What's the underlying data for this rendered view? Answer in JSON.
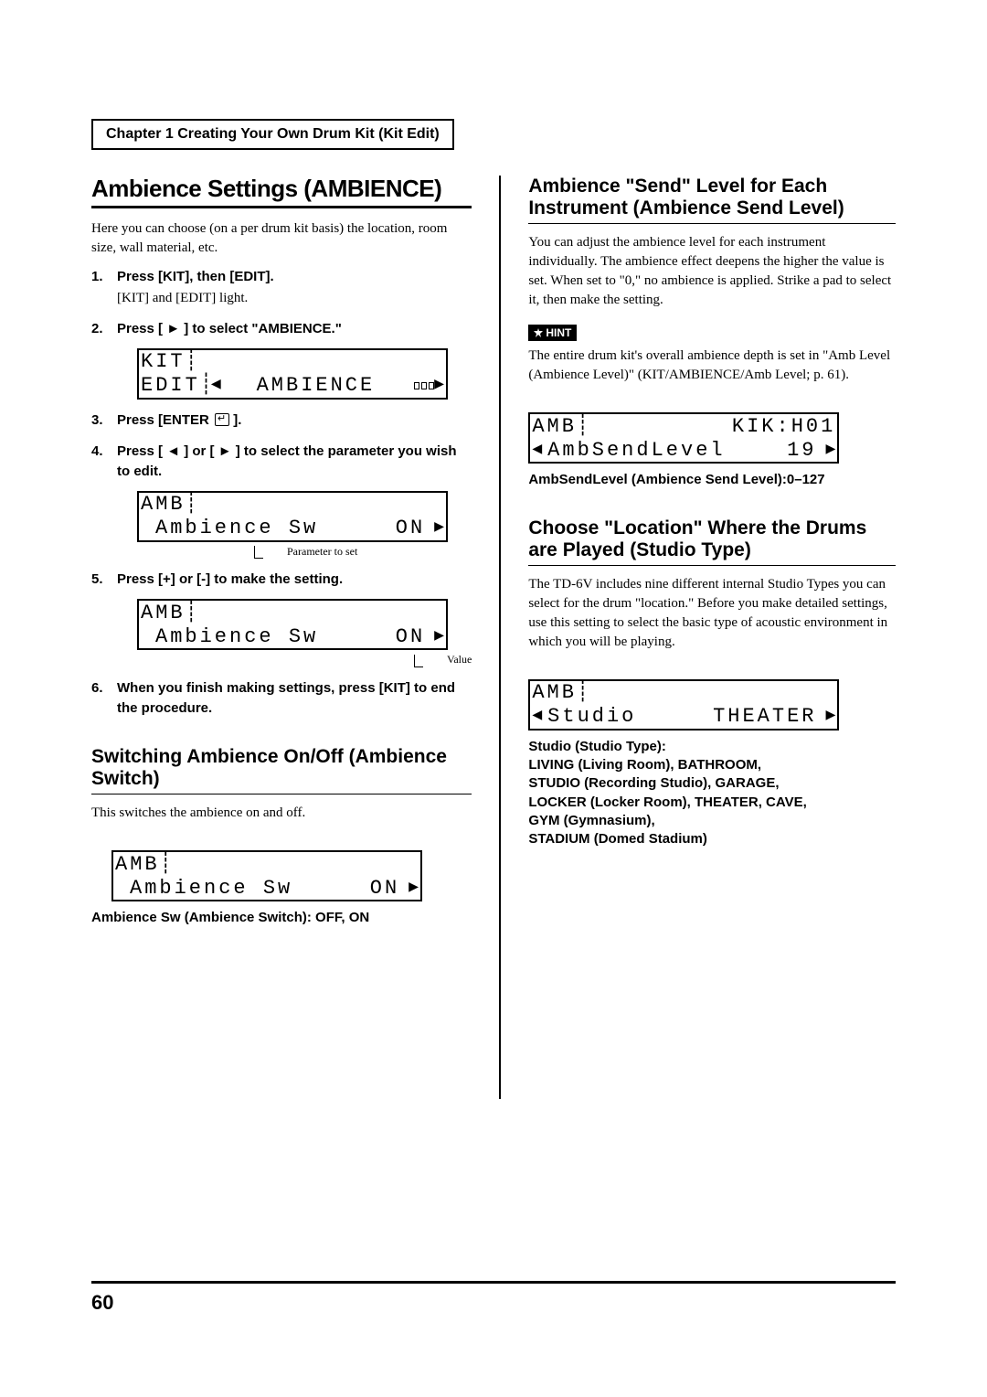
{
  "chapter_header": "Chapter 1 Creating Your Own Drum Kit (Kit Edit)",
  "page_number": "60",
  "left": {
    "h1": "Ambience Settings (AMBIENCE)",
    "intro": "Here you can choose (on a per drum kit basis) the location, room size, wall material, etc.",
    "steps": {
      "s1_bold": "Press [KIT], then [EDIT].",
      "s1_note": "[KIT] and [EDIT] light.",
      "s2_bold_a": "Press [ ",
      "s2_bold_b": " ] to select \"AMBIENCE.\"",
      "s3_bold": "Press [ENTER ",
      "s3_bold_b": " ].",
      "s4_bold_a": "Press [ ",
      "s4_bold_mid": " ] or [ ",
      "s4_bold_b": " ] to select the parameter you wish to edit.",
      "s5_bold": "Press [+] or [-] to make the setting.",
      "s6_bold": "When you finish making settings, press [KIT] to end the procedure."
    },
    "callout_param": "Parameter to set",
    "callout_value": "Value",
    "sub_h2": "Switching Ambience On/Off (Ambience Switch)",
    "sub_body": "This switches the ambience on and off.",
    "sub_param_line": "Ambience Sw (Ambience Switch): OFF, ON",
    "lcd_kit": {
      "row1_a": "KIT",
      "row2_a": "EDIT",
      "row2_mid": "AMBIENCE"
    },
    "lcd_amb1": {
      "row1": "AMB",
      "row2_a": "Ambience Sw",
      "row2_b": "ON"
    },
    "lcd_amb2": {
      "row1": "AMB",
      "row2_a": "Ambience Sw",
      "row2_b": "ON"
    },
    "lcd_amb3": {
      "row1": "AMB",
      "row2_a": "Ambience Sw",
      "row2_b": "ON"
    }
  },
  "right": {
    "h2a": "Ambience \"Send\" Level for Each Instrument (Ambience Send Level)",
    "body_a": "You can adjust the ambience level for each instrument individually. The ambience effect deepens the higher the value is set. When set to \"0,\" no ambience is applied. Strike a pad to select it, then make the setting.",
    "hint_label": "HINT",
    "hint_body": "The entire drum kit's overall ambience depth is set in \"Amb Level (Ambience Level)\" (KIT/AMBIENCE/Amb Level; p. 61).",
    "lcd_send": {
      "row1_a": "AMB",
      "row1_b": "KIK:H01",
      "row2_a": "AmbSendLevel",
      "row2_b": "19"
    },
    "send_param_line": "AmbSendLevel (Ambience Send Level):0–127",
    "h2b": "Choose \"Location\" Where the Drums are Played (Studio Type)",
    "body_b": "The TD-6V includes nine different internal Studio Types you can select for the drum \"location.\" Before you make detailed settings, use this setting to select the basic type of acoustic environment in which you will be playing.",
    "lcd_studio": {
      "row1": "AMB",
      "row2_a": "Studio",
      "row2_b": "THEATER"
    },
    "studio_lines": {
      "a": "Studio (Studio Type):",
      "b": "LIVING (Living Room), BATHROOM,",
      "c": "STUDIO (Recording Studio), GARAGE,",
      "d": "LOCKER (Locker Room), THEATER, CAVE,",
      "e": "GYM (Gymnasium),",
      "f": "STADIUM (Domed Stadium)"
    }
  }
}
